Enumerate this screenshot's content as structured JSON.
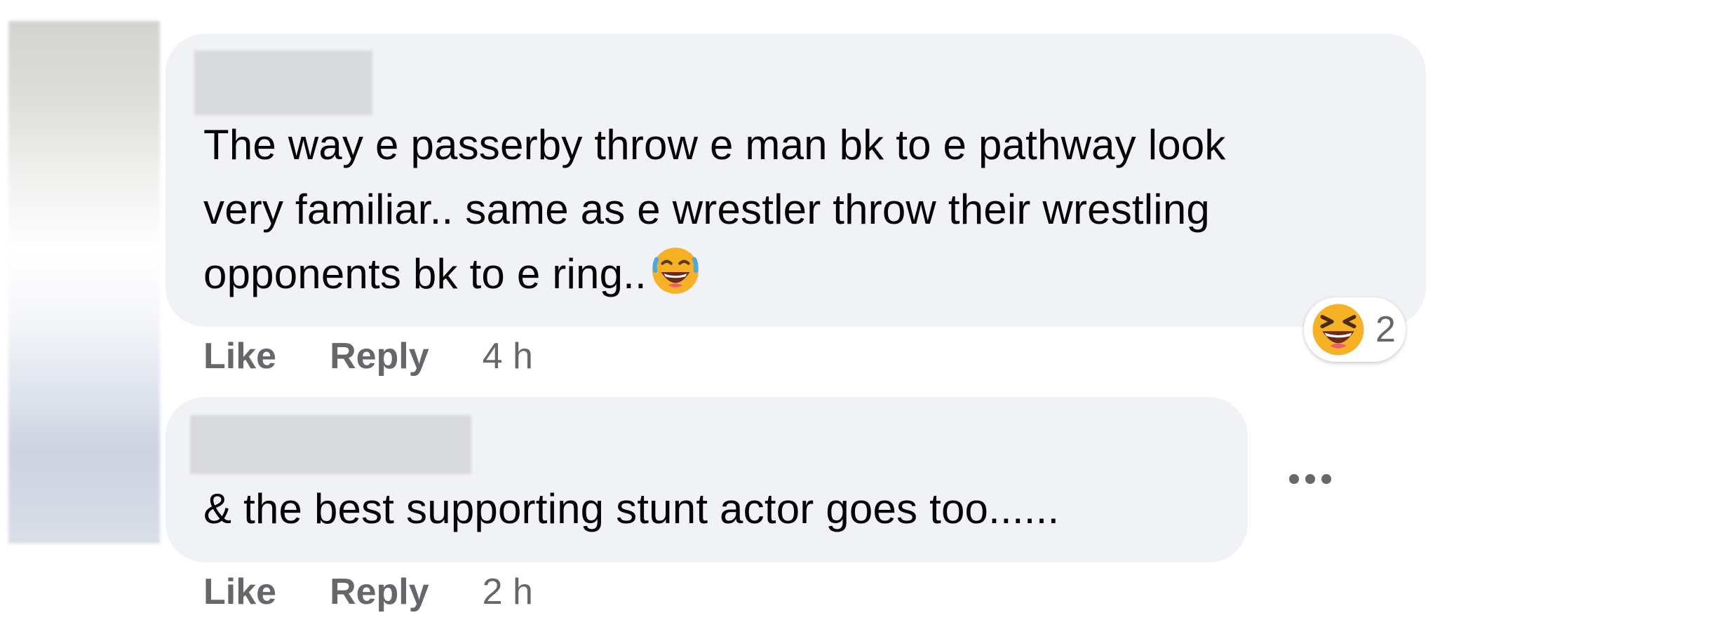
{
  "comments": [
    {
      "text_lines": [
        "The way e passerby throw e man bk to e pathway look",
        "very familiar.. same as e wrestler throw their wrestling",
        "opponents bk to e ring.."
      ],
      "inline_emoji": "face-with-tears-of-joy-icon",
      "actions": {
        "like": "Like",
        "reply": "Reply",
        "time": "4 h"
      },
      "reaction": {
        "icon": "laughing-face-icon",
        "count": "2"
      }
    },
    {
      "text": "& the best supporting stunt actor goes too......",
      "actions": {
        "like": "Like",
        "reply": "Reply",
        "time": "2 h"
      },
      "menu_icon": "more-options-icon"
    }
  ],
  "colors": {
    "bubble": "#f0f2f5",
    "text": "#050505",
    "secondary": "#65676b",
    "emoji_yellow": "#f7b125"
  }
}
